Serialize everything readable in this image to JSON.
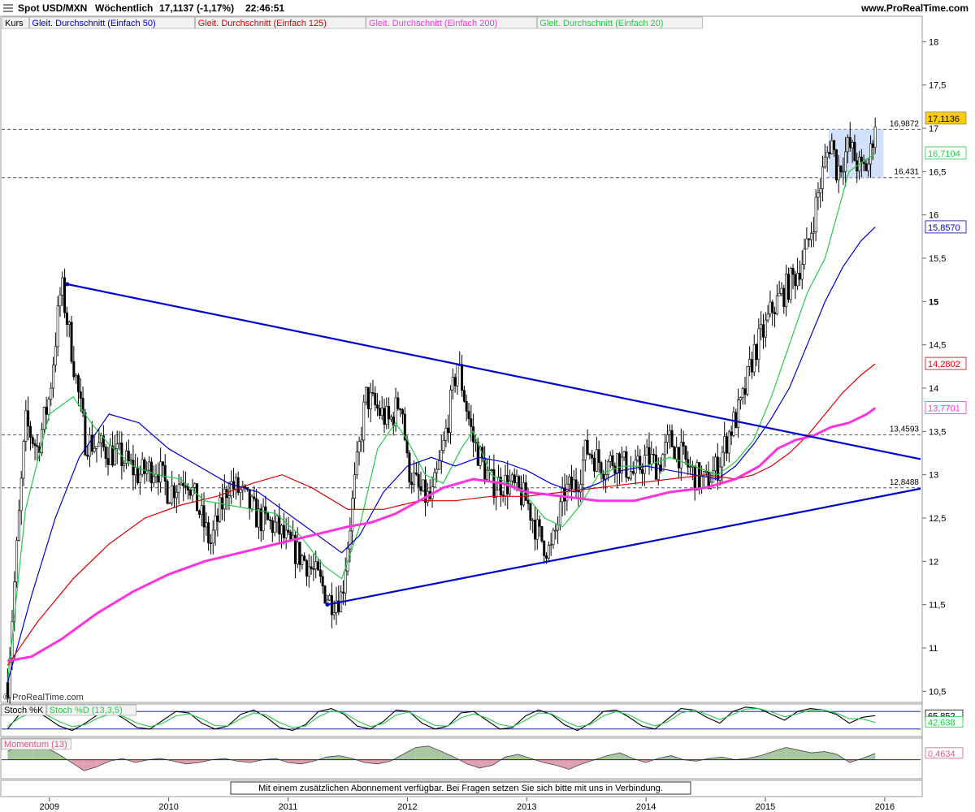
{
  "header": {
    "title": "Spot USD/MXN",
    "interval": "Wöchentlich",
    "price_change": "17,1137 (-1,17%)",
    "time": "22:46:51",
    "brand": "www.ProRealTime.com",
    "watermark": "© ProRealTime.com",
    "notice": "Mit einem zusätzlichen Abonnement verfügbar. Bei Fragen setzen Sie sich bitte mit uns in Verbindung."
  },
  "colors": {
    "price": "#000000",
    "ma50": "#0000cc",
    "ma125": "#dd0000",
    "ma200": "#ff33dd",
    "ma20": "#22cc44",
    "trendline": "#0000cc",
    "zone": "#c8d8f8",
    "current_badge": "#ffcc00",
    "momentum_pos": "#a8c8a0",
    "momentum_neg": "#e0a0b0"
  },
  "chart_data": [
    {
      "type": "candlestick",
      "name": "price-panel",
      "ylim": [
        10.4,
        18.2
      ],
      "y_ticks": [
        "18",
        "17,5",
        "17",
        "16,5",
        "16",
        "15,5",
        "15",
        "14,5",
        "14",
        "13,5",
        "13",
        "12,5",
        "12",
        "11,5",
        "11",
        "10,5"
      ],
      "x_ticks": [
        "2009",
        "2010",
        "2011",
        "2012",
        "2013",
        "2014",
        "2015",
        "2016"
      ],
      "x_tick_years": [
        2009,
        2010,
        2011,
        2012,
        2013,
        2014,
        2015,
        2016
      ],
      "x_range": [
        2008.6,
        2016.3
      ],
      "legend": [
        {
          "key": "price",
          "label": "Kurs",
          "color": "#000000"
        },
        {
          "key": "ma50",
          "label": "Gleit. Durchschnitt (Einfach 50)",
          "color": "#0000cc"
        },
        {
          "key": "ma125",
          "label": "Gleit. Durchschnitt (Einfach 125)",
          "color": "#dd0000"
        },
        {
          "key": "ma200",
          "label": "Gleit. Durchschnitt (Einfach 200)",
          "color": "#ff33dd"
        },
        {
          "key": "ma20",
          "label": "Gleit. Durchschnitt (Einfach 20)",
          "color": "#22cc44"
        }
      ],
      "series": [
        {
          "key": "price",
          "name": "Kurs",
          "x": [
            2008.65,
            2008.72,
            2008.8,
            2008.9,
            2009.0,
            2009.1,
            2009.17,
            2009.3,
            2009.45,
            2009.6,
            2009.75,
            2009.9,
            2010.0,
            2010.15,
            2010.25,
            2010.35,
            2010.5,
            2010.6,
            2010.75,
            2010.9,
            2011.0,
            2011.15,
            2011.25,
            2011.35,
            2011.45,
            2011.55,
            2011.65,
            2011.72,
            2011.85,
            2011.95,
            2012.0,
            2012.1,
            2012.2,
            2012.3,
            2012.42,
            2012.55,
            2012.7,
            2012.85,
            2013.0,
            2013.1,
            2013.2,
            2013.32,
            2013.42,
            2013.5,
            2013.65,
            2013.75,
            2013.9,
            2014.0,
            2014.1,
            2014.2,
            2014.3,
            2014.4,
            2014.5,
            2014.6,
            2014.7,
            2014.8,
            2014.9,
            2015.0,
            2015.05,
            2015.15,
            2015.25,
            2015.35,
            2015.45,
            2015.55,
            2015.6,
            2015.7,
            2015.8,
            2015.87,
            2015.92
          ],
          "y": [
            10.6,
            12.0,
            13.6,
            13.3,
            13.9,
            15.2,
            14.6,
            13.4,
            13.3,
            13.2,
            13.0,
            13.1,
            12.8,
            13.0,
            12.6,
            12.2,
            12.9,
            12.8,
            12.5,
            12.4,
            12.2,
            12.0,
            11.8,
            11.55,
            11.6,
            12.8,
            13.9,
            13.8,
            13.6,
            13.9,
            13.1,
            12.8,
            12.7,
            13.3,
            14.3,
            13.4,
            12.9,
            12.9,
            12.7,
            12.3,
            12.1,
            12.8,
            12.9,
            13.3,
            13.1,
            13.2,
            13.0,
            13.2,
            13.1,
            13.4,
            13.2,
            13.0,
            12.9,
            13.1,
            13.5,
            13.8,
            14.4,
            14.7,
            14.9,
            15.1,
            15.3,
            15.6,
            16.3,
            16.9,
            16.5,
            16.8,
            16.5,
            16.6,
            17.1
          ]
        },
        {
          "key": "ma20",
          "name": "Gleit. Durchschnitt (Einfach 20)",
          "x": [
            2008.65,
            2008.8,
            2009.0,
            2009.2,
            2009.35,
            2009.5,
            2009.7,
            2009.9,
            2010.1,
            2010.3,
            2010.5,
            2010.7,
            2010.9,
            2011.1,
            2011.3,
            2011.45,
            2011.6,
            2011.75,
            2011.9,
            2012.0,
            2012.15,
            2012.3,
            2012.45,
            2012.55,
            2012.7,
            2012.85,
            2013.0,
            2013.15,
            2013.3,
            2013.45,
            2013.6,
            2013.8,
            2014.0,
            2014.2,
            2014.4,
            2014.6,
            2014.75,
            2014.9,
            2015.05,
            2015.2,
            2015.35,
            2015.5,
            2015.6,
            2015.7,
            2015.8,
            2015.92
          ],
          "y": [
            10.6,
            12.6,
            13.7,
            13.9,
            13.6,
            13.35,
            13.1,
            13.0,
            12.95,
            12.7,
            12.65,
            12.6,
            12.55,
            12.3,
            11.95,
            11.8,
            12.4,
            13.3,
            13.6,
            13.4,
            13.0,
            12.9,
            13.3,
            13.5,
            13.0,
            12.9,
            12.75,
            12.5,
            12.4,
            12.65,
            13.0,
            13.1,
            13.1,
            13.2,
            13.1,
            13.0,
            13.15,
            13.4,
            13.9,
            14.5,
            15.1,
            15.5,
            16.0,
            16.5,
            16.6,
            16.71
          ]
        },
        {
          "key": "ma50",
          "name": "Gleit. Durchschnitt (Einfach 50)",
          "x": [
            2008.65,
            2008.85,
            2009.05,
            2009.25,
            2009.5,
            2009.75,
            2010.0,
            2010.25,
            2010.5,
            2010.75,
            2011.0,
            2011.25,
            2011.45,
            2011.6,
            2011.8,
            2012.0,
            2012.2,
            2012.4,
            2012.6,
            2012.8,
            2013.0,
            2013.2,
            2013.4,
            2013.6,
            2013.8,
            2014.0,
            2014.2,
            2014.4,
            2014.6,
            2014.75,
            2014.9,
            2015.05,
            2015.2,
            2015.35,
            2015.5,
            2015.65,
            2015.8,
            2015.92
          ],
          "y": [
            10.6,
            11.6,
            12.5,
            13.2,
            13.7,
            13.6,
            13.3,
            13.1,
            12.9,
            12.8,
            12.55,
            12.3,
            12.1,
            12.3,
            12.8,
            13.1,
            13.2,
            13.1,
            13.2,
            13.15,
            13.05,
            12.9,
            12.8,
            12.9,
            13.05,
            13.1,
            13.05,
            13.0,
            12.95,
            13.1,
            13.35,
            13.65,
            14.0,
            14.5,
            15.0,
            15.4,
            15.7,
            15.86
          ]
        },
        {
          "key": "ma125",
          "name": "Gleit. Durchschnitt (Einfach 125)",
          "x": [
            2008.65,
            2008.9,
            2009.2,
            2009.5,
            2009.8,
            2010.1,
            2010.4,
            2010.7,
            2010.95,
            2011.2,
            2011.5,
            2011.8,
            2012.1,
            2012.4,
            2012.7,
            2013.0,
            2013.3,
            2013.6,
            2013.9,
            2014.2,
            2014.5,
            2014.75,
            2014.9,
            2015.05,
            2015.2,
            2015.35,
            2015.5,
            2015.65,
            2015.8,
            2015.92
          ],
          "y": [
            10.8,
            11.3,
            11.8,
            12.2,
            12.5,
            12.65,
            12.75,
            12.9,
            13.0,
            12.85,
            12.6,
            12.6,
            12.7,
            12.7,
            12.75,
            12.75,
            12.8,
            12.85,
            12.9,
            12.95,
            13.0,
            12.95,
            13.0,
            13.1,
            13.25,
            13.45,
            13.7,
            13.95,
            14.15,
            14.28
          ]
        },
        {
          "key": "ma200",
          "name": "Gleit. Durchschnitt (Einfach 200)",
          "x": [
            2008.65,
            2008.85,
            2009.1,
            2009.4,
            2009.7,
            2010.0,
            2010.3,
            2010.6,
            2010.9,
            2011.2,
            2011.5,
            2011.7,
            2011.9,
            2012.1,
            2012.3,
            2012.55,
            2012.8,
            2013.0,
            2013.3,
            2013.6,
            2013.9,
            2014.2,
            2014.5,
            2014.75,
            2014.95,
            2015.1,
            2015.25,
            2015.4,
            2015.55,
            2015.7,
            2015.85,
            2015.92
          ],
          "y": [
            10.85,
            10.9,
            11.1,
            11.4,
            11.65,
            11.85,
            12.0,
            12.1,
            12.2,
            12.3,
            12.4,
            12.45,
            12.55,
            12.7,
            12.85,
            12.95,
            12.9,
            12.8,
            12.75,
            12.7,
            12.7,
            12.8,
            12.85,
            12.95,
            13.1,
            13.3,
            13.4,
            13.45,
            13.55,
            13.6,
            13.7,
            13.77
          ]
        }
      ],
      "trendlines": [
        {
          "name": "upper-trendline",
          "x": [
            2009.15,
            2016.3
          ],
          "y": [
            15.2,
            13.18
          ]
        },
        {
          "name": "lower-trendline",
          "x": [
            2011.33,
            2016.3
          ],
          "y": [
            11.5,
            12.84
          ]
        }
      ],
      "range_box": {
        "x": [
          2015.53,
          2015.99
        ],
        "y": [
          16.431,
          16.9872
        ]
      },
      "levels": [
        {
          "label": "16,9872",
          "value": 16.9872
        },
        {
          "label": "16,431",
          "value": 16.431
        },
        {
          "label": "13,4593",
          "value": 13.4593
        },
        {
          "label": "12,8488",
          "value": 12.8488
        }
      ],
      "right_labels": [
        {
          "series": "price",
          "label": "17,1136",
          "value": 17.1136,
          "style": "badge"
        },
        {
          "series": "ma20",
          "label": "16,7104",
          "value": 16.7104
        },
        {
          "series": "ma50",
          "label": "15,8570",
          "value": 15.857
        },
        {
          "series": "ma125",
          "label": "14,2802",
          "value": 14.2802
        },
        {
          "series": "ma200",
          "label": "13,7701",
          "value": 13.7701
        }
      ]
    },
    {
      "type": "line",
      "name": "stochastic-panel",
      "ylim": [
        0,
        100
      ],
      "legend": [
        {
          "key": "k",
          "label": "Stoch %K",
          "color": "#000000"
        },
        {
          "key": "d",
          "label": "Stoch %D (13,3,5)",
          "color": "#22cc44"
        }
      ],
      "series": [
        {
          "key": "k",
          "name": "Stoch %K",
          "x_range": [
            2008.65,
            2015.92
          ],
          "y": [
            20,
            75,
            85,
            60,
            30,
            15,
            40,
            70,
            80,
            55,
            25,
            20,
            50,
            80,
            75,
            40,
            20,
            30,
            70,
            85,
            60,
            25,
            15,
            35,
            80,
            90,
            70,
            30,
            20,
            45,
            85,
            80,
            40,
            20,
            30,
            75,
            80,
            50,
            20,
            25,
            65,
            85,
            70,
            35,
            15,
            40,
            80,
            85,
            60,
            30,
            20,
            55,
            90,
            85,
            60,
            40,
            80,
            95,
            90,
            70,
            50,
            80,
            90,
            85,
            70,
            40,
            60,
            65.852
          ]
        },
        {
          "key": "d",
          "name": "Stoch %D (13,3,5)",
          "x_range": [
            2008.65,
            2015.92
          ],
          "y": [
            30,
            60,
            78,
            68,
            45,
            28,
            35,
            58,
            72,
            62,
            40,
            28,
            40,
            65,
            72,
            55,
            32,
            30,
            55,
            75,
            68,
            42,
            25,
            30,
            62,
            82,
            75,
            48,
            28,
            38,
            68,
            78,
            55,
            32,
            30,
            58,
            72,
            58,
            35,
            28,
            50,
            75,
            72,
            48,
            28,
            35,
            65,
            80,
            68,
            45,
            30,
            45,
            75,
            85,
            70,
            52,
            70,
            88,
            90,
            78,
            62,
            72,
            85,
            85,
            75,
            55,
            55,
            42.638
          ]
        }
      ],
      "right_labels": [
        {
          "series": "k",
          "label": "65,852",
          "value": 65.852
        },
        {
          "series": "d",
          "label": "42,638",
          "value": 42.638
        }
      ]
    },
    {
      "type": "area",
      "name": "momentum-panel",
      "ylim": [
        -1.2,
        1.4
      ],
      "legend": [
        {
          "key": "mom",
          "label": "Momentum (13)",
          "color": "#e0a0b0"
        }
      ],
      "series": [
        {
          "key": "mom",
          "name": "Momentum (13)",
          "x_range": [
            2008.65,
            2015.92
          ],
          "y": [
            0.6,
            1.1,
            1.0,
            0.9,
            0.4,
            -0.2,
            -0.8,
            -0.5,
            -0.1,
            0.1,
            -0.2,
            0.0,
            0.1,
            -0.1,
            -0.3,
            -0.2,
            0.0,
            0.1,
            -0.1,
            -0.2,
            0.0,
            0.1,
            -0.2,
            -0.3,
            -0.1,
            0.2,
            0.3,
            0.1,
            -0.2,
            -0.3,
            -0.1,
            0.4,
            0.9,
            1.0,
            0.6,
            0.2,
            -0.3,
            -0.6,
            -0.4,
            0.2,
            0.4,
            0.1,
            -0.2,
            -0.4,
            -0.7,
            -0.3,
            0.0,
            0.3,
            0.5,
            0.1,
            -0.2,
            0.1,
            0.3,
            0.0,
            -0.1,
            0.1,
            0.2,
            0.0,
            0.1,
            0.3,
            0.6,
            0.9,
            0.7,
            0.5,
            0.6,
            0.4,
            -0.2,
            0.1,
            0.4634
          ]
        }
      ],
      "right_labels": [
        {
          "series": "mom",
          "label": "0,4634",
          "value": 0.4634
        }
      ]
    }
  ]
}
